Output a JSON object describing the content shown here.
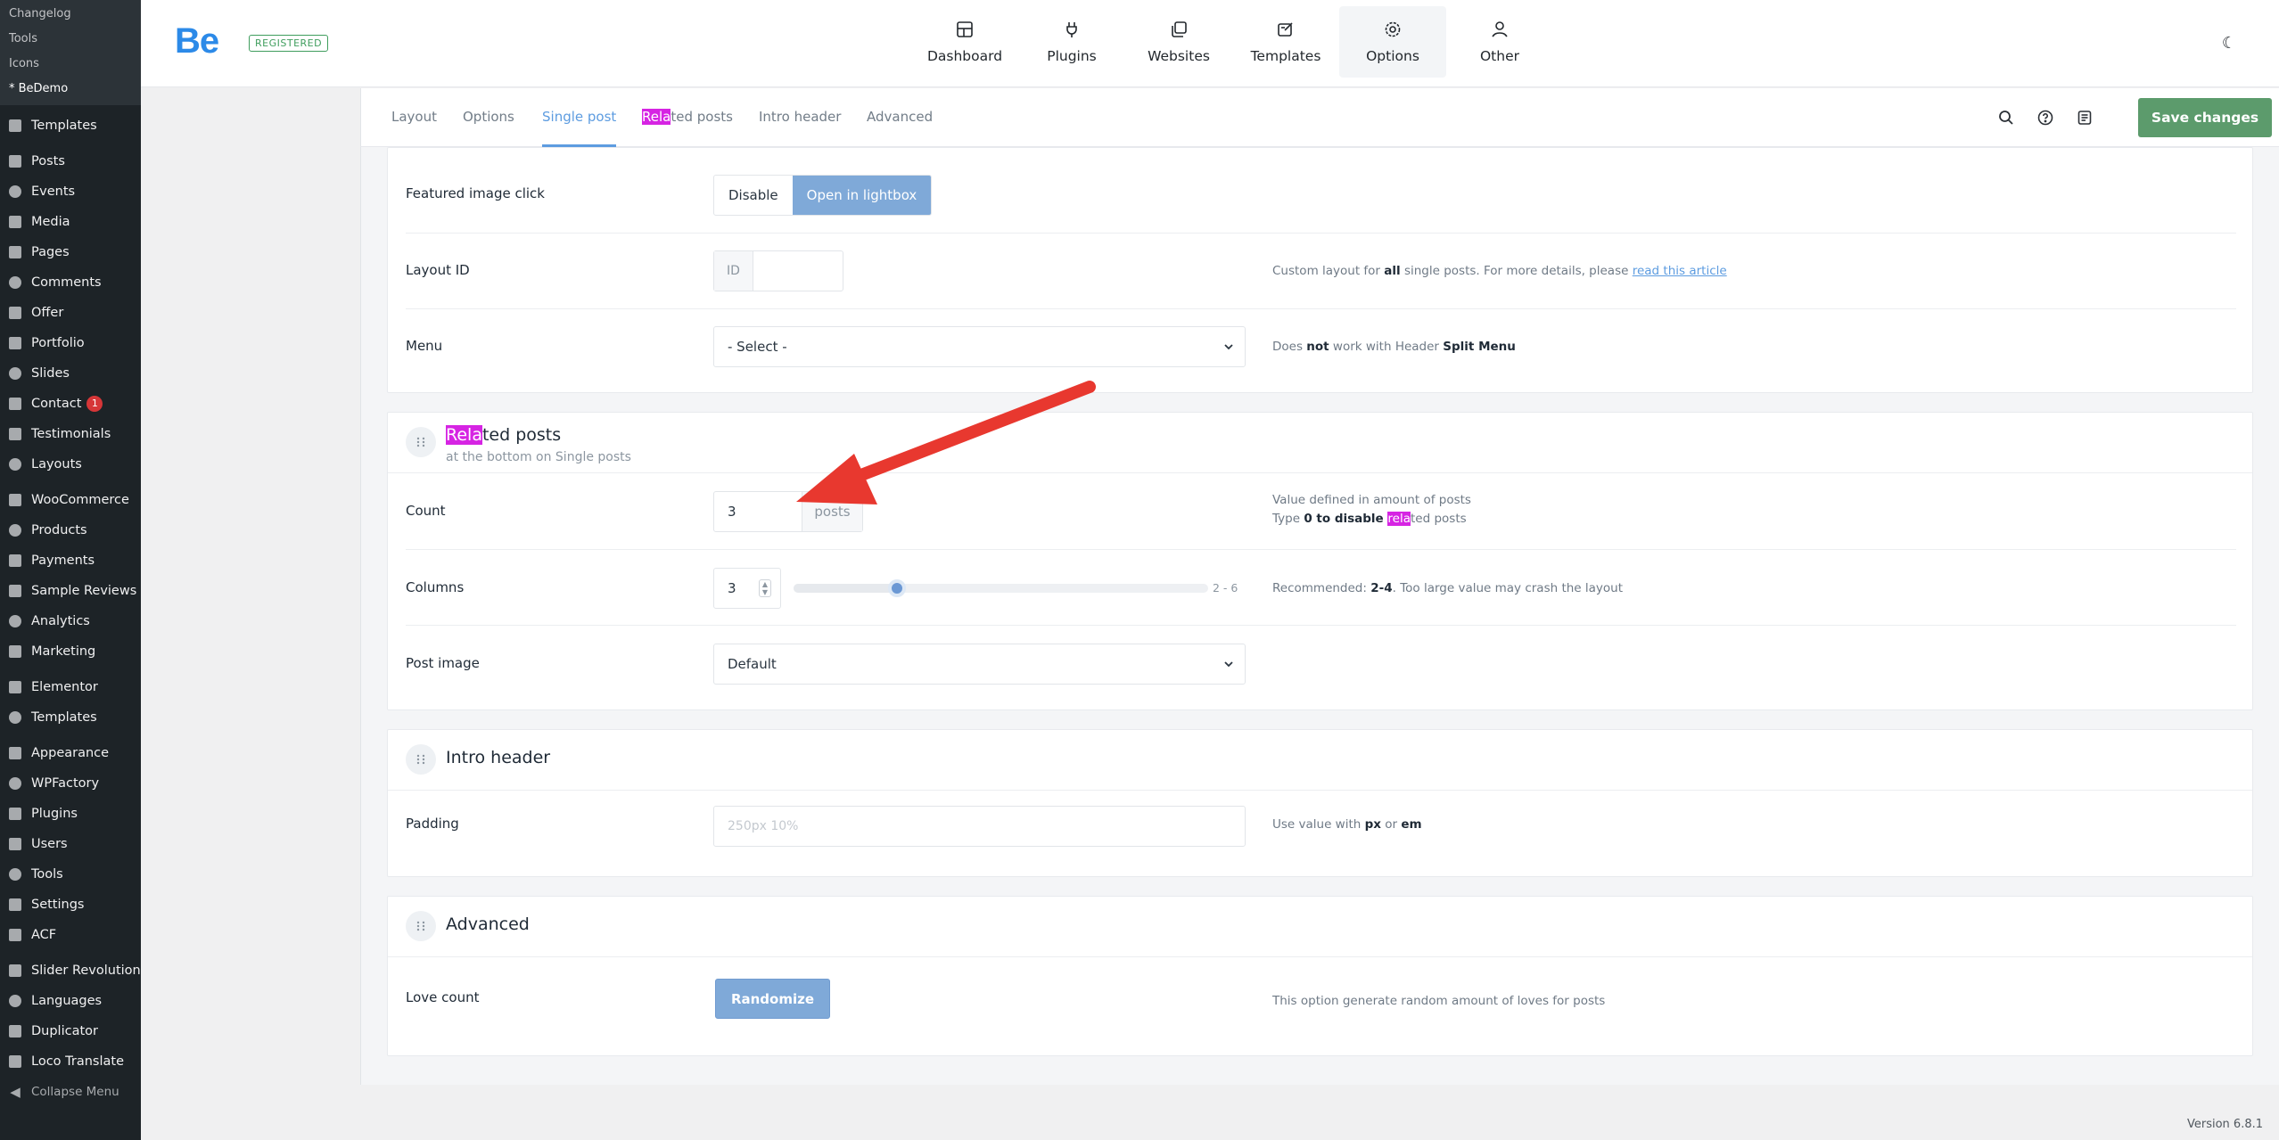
{
  "wp_sidebar": {
    "submenu": [
      "Changelog",
      "Tools",
      "Icons",
      "* BeDemo"
    ],
    "groups": [
      [
        {
          "label": "Templates",
          "icon": "templates-icon"
        }
      ],
      [
        {
          "label": "Posts",
          "icon": "pin-icon"
        },
        {
          "label": "Events",
          "icon": "megaphone-icon"
        },
        {
          "label": "Media",
          "icon": "media-icon"
        },
        {
          "label": "Pages",
          "icon": "pages-icon"
        },
        {
          "label": "Comments",
          "icon": "comments-icon"
        },
        {
          "label": "Offer",
          "icon": "tag-icon"
        },
        {
          "label": "Portfolio",
          "icon": "portfolio-icon"
        },
        {
          "label": "Slides",
          "icon": "slides-icon"
        },
        {
          "label": "Contact",
          "icon": "mail-icon",
          "badge": "1"
        },
        {
          "label": "Testimonials",
          "icon": "quote-icon"
        },
        {
          "label": "Layouts",
          "icon": "brush-icon"
        }
      ],
      [
        {
          "label": "WooCommerce",
          "icon": "woo-icon"
        },
        {
          "label": "Products",
          "icon": "archive-icon"
        },
        {
          "label": "Payments",
          "icon": "money-icon"
        },
        {
          "label": "Sample Reviews",
          "icon": "star-icon"
        },
        {
          "label": "Analytics",
          "icon": "chart-icon"
        },
        {
          "label": "Marketing",
          "icon": "megaphone-icon"
        }
      ],
      [
        {
          "label": "Elementor",
          "icon": "elementor-icon"
        },
        {
          "label": "Templates",
          "icon": "folder-icon"
        }
      ],
      [
        {
          "label": "Appearance",
          "icon": "brush-icon"
        },
        {
          "label": "WPFactory",
          "icon": "factory-icon"
        },
        {
          "label": "Plugins",
          "icon": "plug-icon"
        },
        {
          "label": "Users",
          "icon": "user-icon"
        },
        {
          "label": "Tools",
          "icon": "wrench-icon"
        },
        {
          "label": "Settings",
          "icon": "settings-icon"
        },
        {
          "label": "ACF",
          "icon": "acf-icon"
        }
      ],
      [
        {
          "label": "Slider Revolution",
          "icon": "refresh-icon"
        },
        {
          "label": "Languages",
          "icon": "translate-icon"
        },
        {
          "label": "Duplicator",
          "icon": "duplicate-icon"
        },
        {
          "label": "Loco Translate",
          "icon": "translate-icon"
        }
      ]
    ],
    "collapse": "Collapse Menu"
  },
  "header": {
    "logo": "Be",
    "registered": "REGISTERED",
    "nav": [
      {
        "label": "Dashboard",
        "icon": "dashboard-icon"
      },
      {
        "label": "Plugins",
        "icon": "plug-icon"
      },
      {
        "label": "Websites",
        "icon": "websites-icon"
      },
      {
        "label": "Templates",
        "icon": "templates-icon"
      },
      {
        "label": "Options",
        "icon": "gear-icon",
        "active": true
      },
      {
        "label": "Other",
        "icon": "other-icon"
      }
    ]
  },
  "subnav": {
    "tabs": {
      "layout": "Layout",
      "options": "Options",
      "single_post": "Single post",
      "related_hl": "Rela",
      "related_rest": "ted posts",
      "intro_header": "Intro header",
      "advanced": "Advanced"
    },
    "save_label": "Save changes"
  },
  "single_post": {
    "featured_label": "Featured image click",
    "featured_options": [
      "Disable",
      "Open in lightbox"
    ],
    "layout_id_label": "Layout ID",
    "layout_id_prefix": "ID",
    "layout_id_desc_1": "Custom layout for ",
    "layout_id_desc_bold": "all",
    "layout_id_desc_2": " single posts. For more details, please ",
    "layout_id_desc_link": "read this article",
    "menu_label": "Menu",
    "menu_value": "- Select -",
    "menu_desc_1": "Does ",
    "menu_desc_bold": "not",
    "menu_desc_2": " work with Header ",
    "menu_desc_bold2": "Split Menu"
  },
  "related": {
    "title_hl": "Rela",
    "title_rest": "ted posts",
    "subtitle": "at the bottom on Single posts",
    "count_label": "Count",
    "count_value": "3",
    "count_unit": "posts",
    "count_desc_1": "Value defined in amount of posts",
    "count_desc_2a": "Type ",
    "count_desc_2b": "0 to disable ",
    "count_desc_2hl": "rela",
    "count_desc_2c": "ted posts",
    "columns_label": "Columns",
    "columns_value": "3",
    "columns_slider_value": 3,
    "columns_min": 2,
    "columns_max": 6,
    "columns_range": "2 - 6",
    "columns_desc_1": "Recommended: ",
    "columns_desc_bold": "2-4",
    "columns_desc_2": ". Too large value may crash the layout",
    "post_image_label": "Post image",
    "post_image_value": "Default"
  },
  "intro_header": {
    "title": "Intro header",
    "padding_label": "Padding",
    "padding_placeholder": "250px 10%",
    "padding_desc_1": "Use value with ",
    "padding_desc_px": "px",
    "padding_desc_or": " or ",
    "padding_desc_em": "em"
  },
  "advanced": {
    "title": "Advanced",
    "love_label": "Love count",
    "randomize": "Randomize",
    "love_desc": "This option generate random amount of loves for posts"
  },
  "footer": {
    "version": "Version 6.8.1"
  },
  "colors": {
    "accent": "#5d9ce0",
    "save": "#5c9b6c",
    "highlight": "#d624e3",
    "annotation_arrow": "#e8382f"
  }
}
